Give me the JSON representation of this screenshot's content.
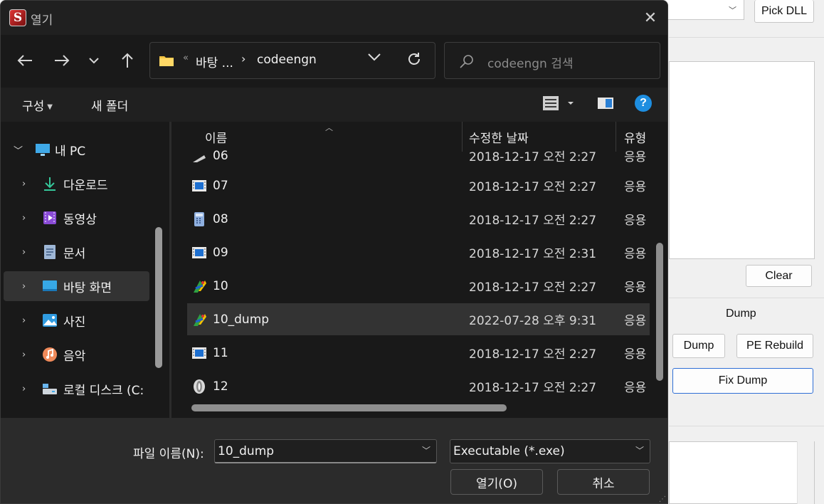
{
  "background_app": {
    "pick_dll": "Pick DLL",
    "clear": "Clear",
    "dump_group_label": "Dump",
    "dump": "Dump",
    "pe_rebuild": "PE Rebuild",
    "fix_dump": "Fix Dump"
  },
  "dialog": {
    "title": "열기",
    "app_icon_letter": "S",
    "close": "✕",
    "address": {
      "overflow": "«",
      "crumbs": [
        "바탕 ...",
        "codeengn"
      ],
      "separator": "›"
    },
    "search_placeholder": "codeengn 검색",
    "toolbar": {
      "organize": "구성",
      "new_folder": "새 폴더"
    },
    "nav": {
      "pc": "내 PC",
      "items": [
        {
          "label": "다운로드",
          "icon": "download-icon"
        },
        {
          "label": "동영상",
          "icon": "video-icon"
        },
        {
          "label": "문서",
          "icon": "document-icon"
        },
        {
          "label": "바탕 화면",
          "icon": "desktop-icon"
        },
        {
          "label": "사진",
          "icon": "pictures-icon"
        },
        {
          "label": "음악",
          "icon": "music-icon"
        },
        {
          "label": "로컬 디스크 (C:",
          "icon": "drive-icon"
        }
      ],
      "selected": "바탕 화면"
    },
    "columns": {
      "name": "이름",
      "modified": "수정한 날짜",
      "type": "유형"
    },
    "files": [
      {
        "name": "06",
        "date": "2018-12-17 오전 2:27",
        "type": "응용",
        "icon": "app-icon"
      },
      {
        "name": "07",
        "date": "2018-12-17 오전 2:27",
        "type": "응용",
        "icon": "window-app-icon"
      },
      {
        "name": "08",
        "date": "2018-12-17 오전 2:27",
        "type": "응용",
        "icon": "calculator-icon"
      },
      {
        "name": "09",
        "date": "2018-12-17 오전 2:31",
        "type": "응용",
        "icon": "window-app-icon"
      },
      {
        "name": "10",
        "date": "2018-12-17 오전 2:27",
        "type": "응용",
        "icon": "colorful-app-icon"
      },
      {
        "name": "10_dump",
        "date": "2022-07-28 오후 9:31",
        "type": "응용",
        "icon": "colorful-app-icon"
      },
      {
        "name": "11",
        "date": "2018-12-17 오전 2:27",
        "type": "응용",
        "icon": "window-app-icon"
      },
      {
        "name": "12",
        "date": "2018-12-17 오전 2:27",
        "type": "응용",
        "icon": "disc-app-icon"
      }
    ],
    "selected_file": "10_dump",
    "footer": {
      "filename_label": "파일 이름(N):",
      "filename_value": "10_dump",
      "filetype_value": "Executable (*.exe)",
      "open": "열기(O)",
      "cancel": "취소"
    }
  }
}
